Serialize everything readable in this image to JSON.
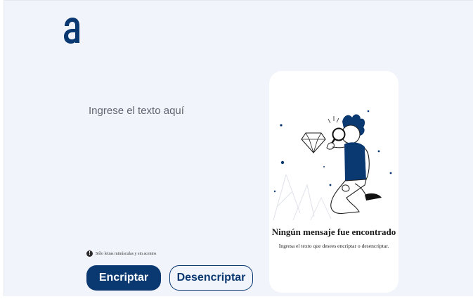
{
  "app": {
    "logo_icon": "alura-logo-icon",
    "brand_color": "#0a3871",
    "background_color": "#f2f4fb"
  },
  "input": {
    "placeholder": "Ingrese el texto aquí",
    "value": ""
  },
  "hint": {
    "icon": "exclamation-circle-icon",
    "text": "Sólo letras minúsculas y sin acentos"
  },
  "buttons": {
    "encrypt_label": "Encriptar",
    "decrypt_label": "Desencriptar"
  },
  "output_panel": {
    "illustration": "boy-with-magnifying-glass-illustration",
    "title": "Ningún mensaje fue encontrado",
    "message": "Ingresa el texto que desees encriptar o desencriptar."
  }
}
